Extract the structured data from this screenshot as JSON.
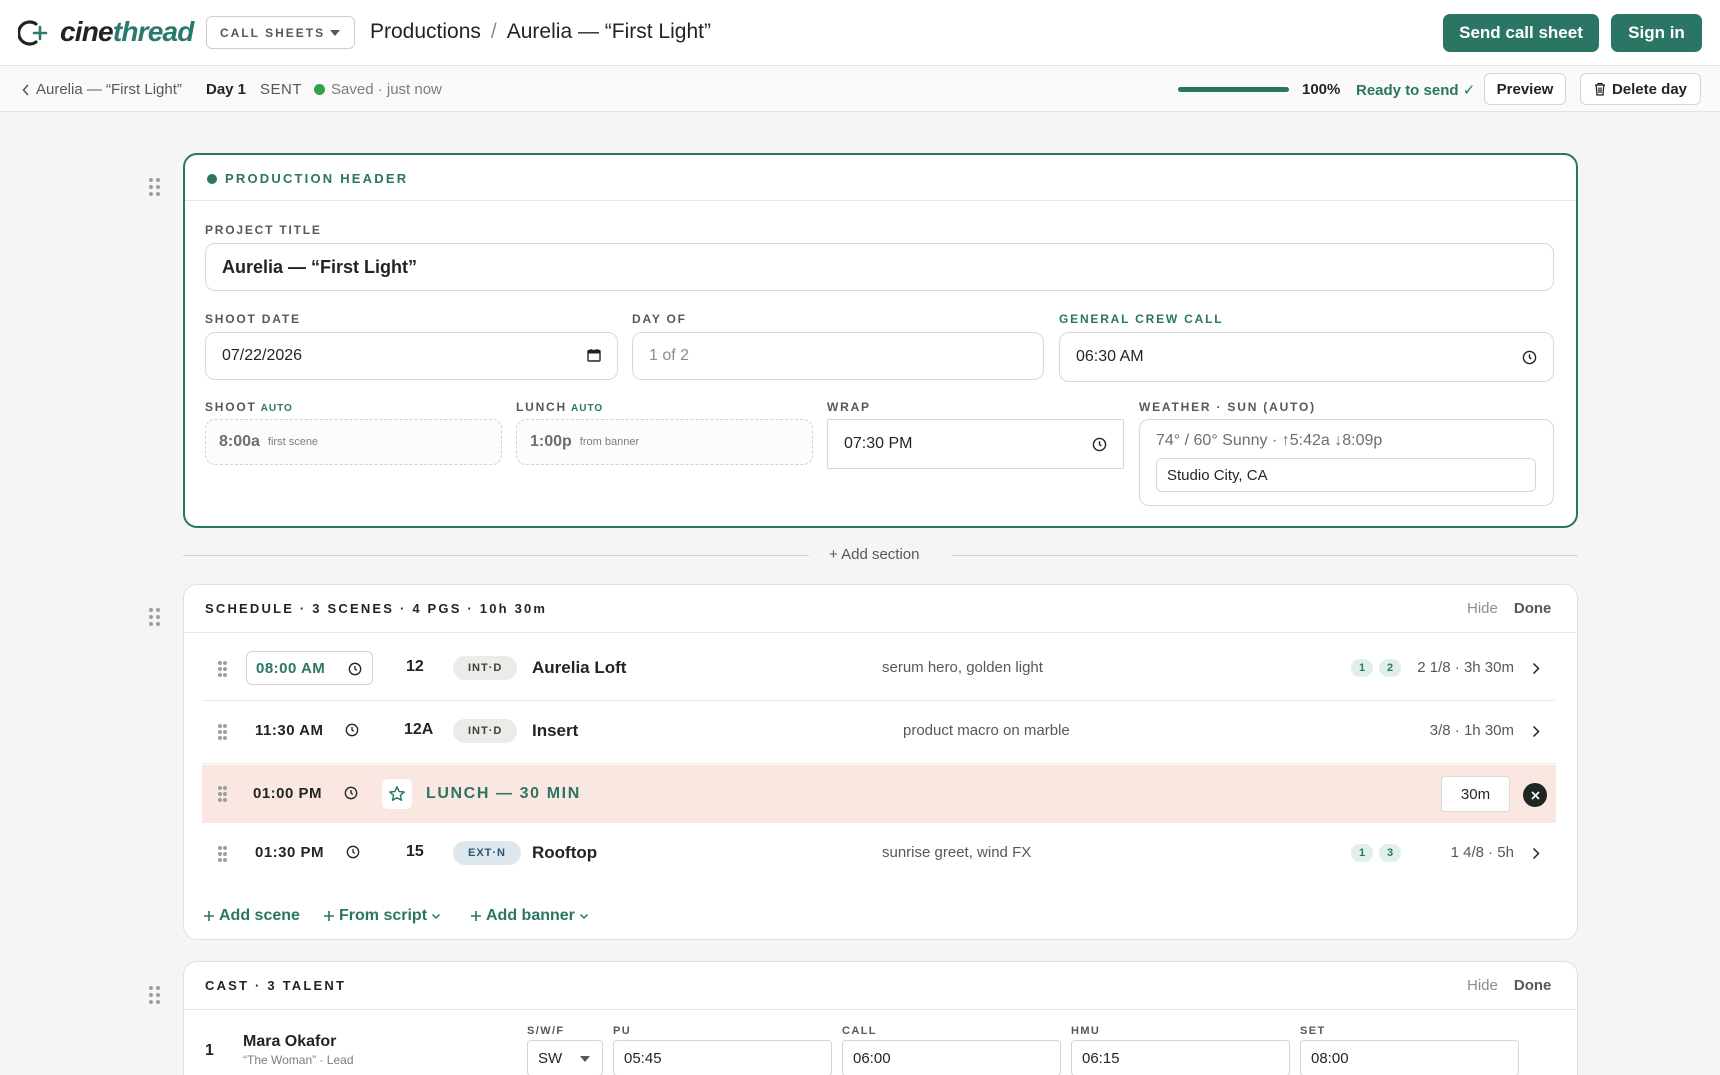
{
  "app": {
    "logo_part1": "cine",
    "logo_part2": "thread",
    "callsheets_label": "CALL SHEETS",
    "breadcrumb": [
      "Productions",
      "/",
      "Aurelia — “First Light”"
    ],
    "send_label": "Send call sheet",
    "signin_label": "Sign in",
    "accent_color": "#2b7565"
  },
  "subbar": {
    "back_label": "Aurelia — “First Light”",
    "day_label": "Day 1",
    "status": "SENT",
    "saved": "Saved · just now",
    "progress_value": 1.0,
    "progress_text": "100%",
    "ready": "Ready to send ✓",
    "preview_label": "Preview",
    "delete_label": "Delete day"
  },
  "production_header": {
    "title": "PRODUCTION HEADER",
    "project_title_label": "PROJECT TITLE",
    "project_title_value": "Aurelia — “First Light”",
    "shoot_date_label": "SHOOT DATE",
    "shoot_date_value": "07/22/2026",
    "day_of_label": "DAY OF",
    "day_of_placeholder": "1 of 2",
    "crew_call_label": "GENERAL CREW CALL",
    "crew_call_value": "06:30 AM",
    "shoot_label": "SHOOT",
    "auto_label": "AUTO",
    "shoot_value": "8:00a",
    "shoot_hint": "first scene",
    "lunch_label": "LUNCH",
    "lunch_value": "1:00p",
    "lunch_hint": "from banner",
    "wrap_label": "WRAP",
    "wrap_value": "07:30 PM",
    "weather_label": "WEATHER · SUN (AUTO)",
    "weather_value": "74° / 60° Sunny · ↑5:42a ↓8:09p",
    "location_value": "Studio City, CA"
  },
  "add_section_label": "+ Add section",
  "schedule": {
    "title": "SCHEDULE · 3 SCENES · 4 PGS · 10h 30m",
    "hide_label": "Hide",
    "done_label": "Done",
    "rows": [
      {
        "time": "08:00 AM",
        "scene": "12",
        "tag": "INT·D",
        "name": "Aurelia Loft",
        "desc": "serum hero, golden light",
        "cast": [
          "1",
          "2"
        ],
        "pages": "2 1/8 · 3h 30m"
      },
      {
        "time": "11:30 AM",
        "scene": "12A",
        "tag": "INT·D",
        "name": "Insert",
        "desc": "product macro on marble",
        "cast": [],
        "pages": "3/8 · 1h 30m"
      },
      {
        "time": "01:00 PM",
        "label": "LUNCH — 30 MIN",
        "duration": "30m"
      },
      {
        "time": "01:30 PM",
        "scene": "15",
        "tag": "EXT·N",
        "name": "Rooftop",
        "desc": "sunrise greet, wind FX",
        "cast": [
          "1",
          "3"
        ],
        "pages": "1 4/8 · 5h"
      }
    ],
    "add_scene": "Add scene",
    "from_script": "From script",
    "add_banner": "Add banner"
  },
  "cast": {
    "title": "CAST · 3 TALENT",
    "hide_label": "Hide",
    "done_label": "Done",
    "columns": [
      "S/W/F",
      "PU",
      "CALL",
      "HMU",
      "SET"
    ],
    "rows": [
      {
        "no": "1",
        "name": "Mara Okafor",
        "role": "“The Woman” · Lead",
        "swf": "SW",
        "pu": "05:45",
        "call": "06:00",
        "hmu": "06:15",
        "set": "08:00"
      }
    ]
  }
}
